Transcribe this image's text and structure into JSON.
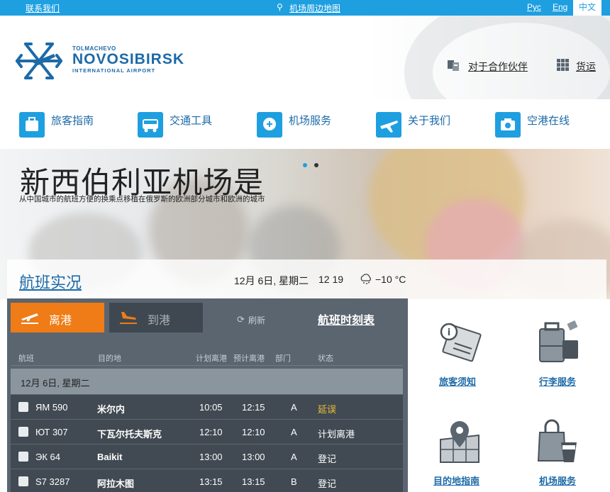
{
  "topbar": {
    "contact": "联系我们",
    "map": "机场周边地图",
    "lang_ru": "Рус",
    "lang_en": "Eng",
    "lang_zh": "中文"
  },
  "logo": {
    "small": "TOLMACHEVO",
    "big": "NOVOSIBIRSK",
    "sub": "INTERNATIONAL AIRPORT"
  },
  "header_links": {
    "partners": "对于合作伙伴",
    "cargo": "货运"
  },
  "nav": {
    "items": [
      {
        "label": "旅客指南",
        "icon": "luggage-icon"
      },
      {
        "label": "交通工具",
        "icon": "bus-icon"
      },
      {
        "label": "机场服务",
        "icon": "services-icon"
      },
      {
        "label": "关于我们",
        "icon": "plane-icon"
      },
      {
        "label": "空港在线",
        "icon": "camera-icon"
      }
    ]
  },
  "hero": {
    "title": "新西伯利亚机场是",
    "subtitle": "从中国城市的航班方便的换乘点移植在俄罗斯的欧洲部分城市和欧洲的城市"
  },
  "flight_strip": {
    "title": "航班实况",
    "date": "12月 6日, 星期二",
    "time": "12  19",
    "temperature": "−10 °C"
  },
  "board": {
    "tab_departures": "离港",
    "tab_arrivals": "到港",
    "refresh": "刷新",
    "schedule": "航班时刻表",
    "columns": {
      "flight": "航班",
      "destination": "目的地",
      "scheduled": "计划离港",
      "estimated": "预计离港",
      "terminal": "部门",
      "status": "状态"
    },
    "day": "12月 6日, 星期二",
    "flights": [
      {
        "flight": "ЯМ 590",
        "destination": "米尔内",
        "scheduled": "10:05",
        "estimated": "12:15",
        "terminal": "A",
        "status": "延误"
      },
      {
        "flight": "ЮТ 307",
        "destination": "下瓦尔托夫斯克",
        "scheduled": "12:10",
        "estimated": "12:10",
        "terminal": "A",
        "status": "计划离港"
      },
      {
        "flight": "ЭК 64",
        "destination": "Baikit",
        "scheduled": "13:00",
        "estimated": "13:00",
        "terminal": "A",
        "status": "登记"
      },
      {
        "flight": "S7 3287",
        "destination": "阿拉木图",
        "scheduled": "13:15",
        "estimated": "13:15",
        "terminal": "B",
        "status": "登记"
      }
    ]
  },
  "services": {
    "passenger_info": "旅客须知",
    "baggage": "行李服务",
    "destinations": "目的地指南",
    "airport_services": "机场服务"
  },
  "colors": {
    "brand_blue": "#1e9fe0",
    "link_blue": "#1c6aa8",
    "accent_orange": "#ef7c16",
    "delay_yellow": "#f2c037"
  }
}
